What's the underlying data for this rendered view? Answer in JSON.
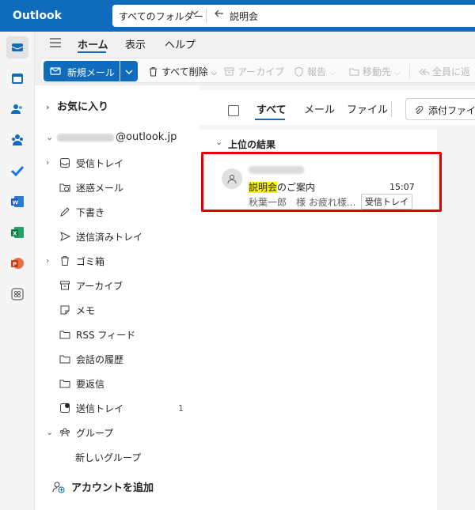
{
  "app": {
    "title": "Outlook"
  },
  "search": {
    "scope": "すべてのフォルダー",
    "query": "説明会"
  },
  "rail": {
    "items": [
      "mail-icon",
      "calendar-icon",
      "people-icon",
      "groups-icon",
      "todo-icon",
      "word-icon",
      "excel-icon",
      "powerpoint-icon",
      "more-apps-icon"
    ]
  },
  "ribbon_tabs": {
    "home": "ホーム",
    "view": "表示",
    "help": "ヘルプ"
  },
  "ribbon": {
    "new_mail": "新規メール",
    "delete_all": "すべて削除",
    "archive": "アーカイブ",
    "report": "報告",
    "move_to": "移動先",
    "reply_all": "全員に返"
  },
  "folders": {
    "favorites": "お気に入り",
    "account_suffix": "@outlook.jp",
    "items": [
      {
        "label": "受信トレイ",
        "icon": "inbox-icon"
      },
      {
        "label": "迷惑メール",
        "icon": "junk-icon"
      },
      {
        "label": "下書き",
        "icon": "draft-icon"
      },
      {
        "label": "送信済みトレイ",
        "icon": "sent-icon"
      },
      {
        "label": "ゴミ箱",
        "icon": "trash-icon"
      },
      {
        "label": "アーカイブ",
        "icon": "archive-icon"
      },
      {
        "label": "メモ",
        "icon": "note-icon"
      },
      {
        "label": "RSS フィード",
        "icon": "folder-icon"
      },
      {
        "label": "会話の履歴",
        "icon": "folder-icon"
      },
      {
        "label": "要返信",
        "icon": "folder-icon"
      },
      {
        "label": "送信トレイ",
        "icon": "outbox-icon",
        "count": "1"
      },
      {
        "label": "グループ",
        "icon": "groups-icon"
      }
    ],
    "new_group": "新しいグループ",
    "add_account": "アカウントを追加"
  },
  "list": {
    "filters": {
      "all": "すべて",
      "mail": "メール",
      "file": "ファイル",
      "attachments": "添付ファイ"
    },
    "section_title": "上位の結果",
    "message": {
      "subject_highlight": "説明会",
      "subject_rest": "のご案内",
      "time": "15:07",
      "preview": "秋葉一郎　様 お疲れ様...",
      "folder_tag": "受信トレイ"
    }
  },
  "colors": {
    "brand": "#0f6cbd",
    "highlight": "#fff100",
    "annotation_box": "#e00000"
  }
}
